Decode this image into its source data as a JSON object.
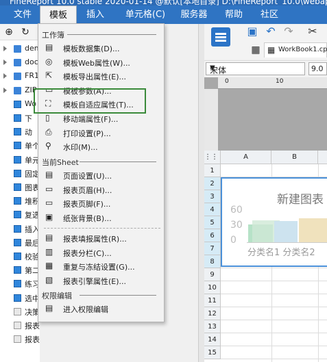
{
  "window": {
    "title": "FineReport 10.0 stable 2020-01-14 @默认[本地目录]    D:\\FineReport_10.0\\webapps"
  },
  "menubar": [
    "文件",
    "模板",
    "插入",
    "单元格(C)",
    "服务器",
    "帮助",
    "社区"
  ],
  "tree": [
    {
      "label": "dem",
      "type": "folder"
    },
    {
      "label": "doc",
      "type": "folder"
    },
    {
      "label": "FR1",
      "type": "folder"
    },
    {
      "label": "ZIP",
      "type": "folder"
    },
    {
      "label": "Wo",
      "type": "file"
    },
    {
      "label": "下",
      "type": "file"
    },
    {
      "label": "动",
      "type": "file"
    },
    {
      "label": "单个",
      "type": "file"
    },
    {
      "label": "单元",
      "type": "file"
    },
    {
      "label": "固定",
      "type": "file"
    },
    {
      "label": "图表",
      "type": "file"
    },
    {
      "label": "堆积",
      "type": "file"
    },
    {
      "label": "复选",
      "type": "file"
    },
    {
      "label": "插入",
      "type": "file"
    },
    {
      "label": "最后",
      "type": "file"
    },
    {
      "label": "校验",
      "type": "file"
    },
    {
      "label": "第二",
      "type": "file"
    },
    {
      "label": "练习",
      "type": "file"
    },
    {
      "label": "选中",
      "type": "file"
    },
    {
      "label": "决策",
      "type": "file-grey"
    },
    {
      "label": "报表",
      "type": "file-grey"
    },
    {
      "label": "报表",
      "type": "file-grey"
    }
  ],
  "dropdown": {
    "section_workbook": "工作簿",
    "workbook_items": [
      "模板数据集(D)...",
      "模板Web属性(W)...",
      "模板导出属性(E)...",
      "模板参数(A)...",
      "模板自适应属性(T)...",
      "移动端属性(F)...",
      "打印设置(P)...",
      "水印(M)..."
    ],
    "section_sheet": "当前Sheet",
    "sheet_items_a": [
      "页面设置(U)...",
      "报表页眉(H)...",
      "报表页脚(F)...",
      "纸张背景(B)..."
    ],
    "sheet_items_b": [
      "报表填报属性(R)...",
      "报表分栏(C)...",
      "重复与冻结设置(G)...",
      "报表引擎属性(E)..."
    ],
    "section_perm": "权限编辑",
    "perm_items": [
      "进入权限编辑"
    ]
  },
  "editor": {
    "tab_label": "WorkBook1.cpt",
    "font_name": "宋体",
    "font_size": "9.0",
    "columns": [
      "A",
      "B"
    ],
    "rows": [
      "1",
      "2",
      "3",
      "4",
      "5",
      "6",
      "7",
      "8",
      "9",
      "10",
      "11",
      "12",
      "13",
      "14",
      "15"
    ]
  },
  "chart_data": {
    "type": "bar",
    "title": "新建图表",
    "yticks": [
      "60",
      "30",
      "0"
    ],
    "categories": [
      "分类名1",
      "分类名2"
    ],
    "category_text": "分类名1 分类名2"
  }
}
